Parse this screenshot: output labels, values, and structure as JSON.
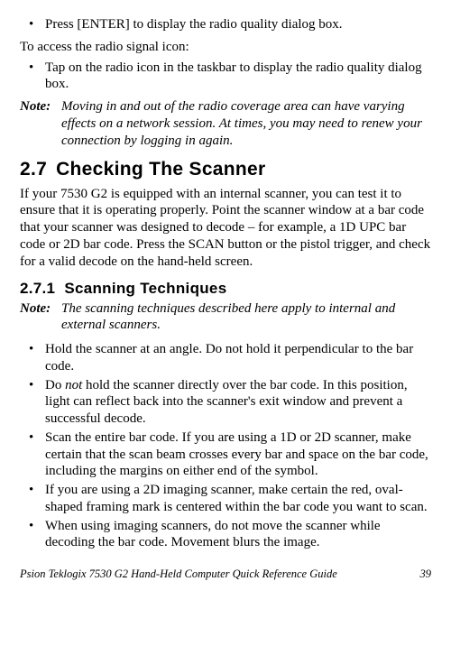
{
  "top_bullets": [
    "Press [ENTER] to display the radio quality dialog box."
  ],
  "intro": "To access the radio signal icon:",
  "access_bullets": [
    "Tap on the radio icon in the taskbar to display the radio quality dialog box."
  ],
  "note1": {
    "label": "Note:",
    "text": "Moving in and out of the radio coverage area can have varying effects on a network session. At times, you may need to renew your connection by logging in again."
  },
  "sec27": {
    "num": "2.7",
    "title": "Checking The Scanner",
    "body": "If your 7530 G2 is equipped with an internal scanner, you can test it to ensure that it is operating properly. Point the scanner window at a bar code that your scanner was designed to decode – for example, a 1D UPC bar code or 2D bar code. Press the SCAN button or the pistol trigger, and check for a valid decode on the hand-held screen."
  },
  "sec271": {
    "num": "2.7.1",
    "title": "Scanning Techniques"
  },
  "note2": {
    "label": "Note:",
    "text": "The scanning techniques described here apply to internal and external scanners."
  },
  "tech_bullets": {
    "b1": "Hold the scanner at an angle. Do not hold it perpendicular to the bar code.",
    "b2_pre": "Do ",
    "b2_em": "not",
    "b2_post": " hold the scanner directly over the bar code. In this position, light can reflect back into the scanner's exit window and prevent a successful decode.",
    "b3": "Scan the entire bar code. If you are using a 1D or 2D scanner, make certain that the scan beam crosses every bar and space on the bar code, including the margins on either end of the symbol.",
    "b4": "If you are using a 2D imaging scanner, make certain the red, oval-shaped framing mark is centered within the bar code you want to scan.",
    "b5": "When using imaging scanners, do not move the scanner while decoding the bar code. Movement blurs the image."
  },
  "footer": {
    "left": "Psion Teklogix 7530 G2 Hand-Held Computer Quick Reference Guide",
    "right": "39"
  }
}
